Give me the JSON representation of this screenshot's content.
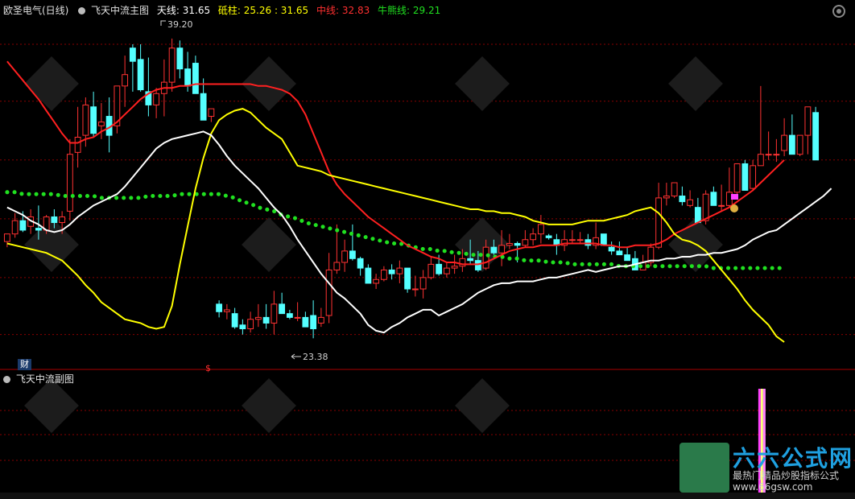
{
  "header": {
    "stock_name": "欧圣电气(日线)",
    "indicator_name": "飞天中流主图",
    "items": [
      {
        "label": "天线: 31.65",
        "color": "#ffffff"
      },
      {
        "label": "砥柱: 25.26 : 31.65",
        "color": "#ffff00"
      },
      {
        "label": "中线: 32.83",
        "color": "#ff3030"
      },
      {
        "label": "牛熊线: 29.21",
        "color": "#20e020"
      }
    ]
  },
  "sub_panel": {
    "title": "飞天中流副图"
  },
  "badges": {
    "cai": "财",
    "dollar": "$"
  },
  "annotations": {
    "high": "39.20",
    "low": "23.38"
  },
  "watermark": {
    "title": "六六公式网",
    "subtitle": "最热门精品炒股指标公式",
    "url": "www.66gsw.com"
  },
  "colors": {
    "up": "#ff3232",
    "down": "#54ffff",
    "tianxian": "#ffffff",
    "dizhu": "#ffff00",
    "zhongxian": "#ff2020",
    "niuxiong": "#20e020",
    "grid": "#8a0000",
    "sub_bar": "#ff40ff"
  },
  "chart_data": {
    "type": "candlestick",
    "ylim": [
      21.8,
      40.3
    ],
    "price_grid": [
      38.9,
      35.9,
      32.8,
      29.7,
      26.6,
      23.6
    ],
    "candles": [
      [
        28.5,
        28.9,
        28.2,
        28.9
      ],
      [
        28.9,
        30.0,
        28.7,
        29.6
      ],
      [
        29.6,
        30.1,
        29.0,
        29.1
      ],
      [
        29.3,
        30.2,
        28.9,
        29.8
      ],
      [
        29.2,
        30.4,
        28.6,
        29.1
      ],
      [
        29.1,
        29.9,
        28.9,
        29.8
      ],
      [
        29.8,
        30.2,
        29.2,
        29.5
      ],
      [
        29.5,
        30.1,
        28.9,
        29.8
      ],
      [
        30.1,
        33.9,
        29.6,
        33.1
      ],
      [
        33.2,
        35.6,
        32.4,
        34.0
      ],
      [
        34.1,
        36.1,
        33.5,
        35.7
      ],
      [
        35.6,
        36.4,
        34.0,
        34.2
      ],
      [
        34.6,
        35.8,
        33.9,
        34.8
      ],
      [
        35.1,
        36.1,
        33.2,
        34.1
      ],
      [
        34.6,
        36.7,
        34.2,
        36.7
      ],
      [
        36.7,
        38.3,
        35.6,
        37.3
      ],
      [
        38.7,
        38.9,
        36.4,
        38.0
      ],
      [
        38.1,
        38.9,
        36.4,
        36.5
      ],
      [
        36.4,
        38.2,
        35.1,
        35.7
      ],
      [
        35.7,
        36.6,
        35.0,
        36.3
      ],
      [
        36.3,
        38.1,
        35.1,
        36.9
      ],
      [
        36.9,
        39.2,
        36.4,
        38.7
      ],
      [
        38.7,
        39.1,
        37.1,
        37.6
      ],
      [
        37.6,
        38.5,
        36.4,
        36.7
      ],
      [
        37.9,
        38.3,
        36.4,
        36.3
      ],
      [
        36.3,
        37.1,
        35.2,
        34.9
      ],
      [
        35.1,
        35.5,
        34.8,
        35.5
      ],
      [
        25.2,
        25.4,
        24.5,
        24.8
      ],
      [
        24.8,
        25.2,
        24.4,
        24.9
      ],
      [
        24.7,
        25.0,
        23.9,
        24.0
      ],
      [
        24.1,
        24.4,
        23.6,
        23.9
      ],
      [
        23.9,
        24.8,
        23.7,
        24.4
      ],
      [
        24.4,
        25.2,
        24.0,
        24.5
      ],
      [
        24.5,
        25.2,
        23.9,
        24.2
      ],
      [
        24.2,
        25.9,
        23.6,
        25.2
      ],
      [
        25.2,
        25.8,
        24.8,
        24.7
      ],
      [
        24.7,
        24.9,
        24.4,
        24.5
      ],
      [
        24.5,
        25.3,
        24.3,
        24.5
      ],
      [
        24.5,
        24.8,
        24.0,
        24.0
      ],
      [
        24.6,
        25.4,
        23.4,
        23.9
      ],
      [
        24.2,
        25.0,
        24.0,
        24.5
      ],
      [
        24.6,
        27.9,
        24.2,
        27.0
      ],
      [
        27.0,
        29.4,
        26.8,
        27.4
      ],
      [
        27.4,
        28.6,
        26.9,
        28.0
      ],
      [
        28.0,
        29.4,
        27.5,
        27.6
      ],
      [
        27.6,
        27.7,
        26.7,
        27.1
      ],
      [
        27.1,
        27.3,
        26.3,
        26.3
      ],
      [
        26.3,
        26.8,
        26.0,
        26.5
      ],
      [
        26.5,
        27.2,
        26.4,
        27.0
      ],
      [
        27.0,
        27.3,
        26.5,
        26.8
      ],
      [
        26.8,
        27.5,
        26.3,
        27.1
      ],
      [
        27.1,
        26.9,
        25.8,
        26.0
      ],
      [
        26.0,
        26.7,
        25.6,
        26.0
      ],
      [
        26.0,
        27.0,
        25.5,
        26.6
      ],
      [
        26.6,
        27.7,
        26.5,
        27.3
      ],
      [
        27.3,
        27.8,
        26.7,
        26.8
      ],
      [
        26.8,
        27.4,
        26.6,
        27.1
      ],
      [
        27.1,
        27.8,
        26.8,
        27.2
      ],
      [
        27.2,
        28.1,
        26.9,
        27.6
      ],
      [
        27.6,
        28.6,
        27.3,
        27.5
      ],
      [
        27.5,
        28.0,
        26.9,
        27.0
      ],
      [
        27.1,
        28.6,
        27.0,
        28.2
      ],
      [
        28.2,
        28.6,
        27.8,
        27.9
      ],
      [
        27.9,
        29.1,
        27.2,
        28.3
      ],
      [
        28.3,
        28.9,
        28.1,
        28.4
      ],
      [
        28.4,
        28.5,
        27.4,
        28.3
      ],
      [
        28.3,
        29.1,
        28.2,
        28.6
      ],
      [
        28.6,
        29.2,
        28.3,
        28.9
      ],
      [
        28.9,
        29.9,
        28.4,
        29.4
      ],
      [
        28.8,
        28.9,
        28.6,
        28.7
      ],
      [
        28.6,
        28.9,
        27.8,
        28.3
      ],
      [
        28.3,
        29.1,
        28.0,
        28.6
      ],
      [
        28.6,
        29.1,
        28.4,
        28.6
      ],
      [
        28.6,
        29.0,
        28.4,
        28.6
      ],
      [
        28.6,
        28.9,
        28.1,
        28.3
      ],
      [
        28.3,
        29.5,
        28.1,
        28.7
      ],
      [
        28.9,
        28.8,
        28.5,
        28.3
      ],
      [
        28.2,
        28.5,
        27.8,
        28.0
      ],
      [
        28.0,
        28.5,
        27.8,
        27.8
      ],
      [
        27.8,
        28.2,
        27.6,
        27.5
      ],
      [
        27.6,
        28.0,
        27.3,
        27.0
      ],
      [
        27.0,
        27.8,
        27.2,
        27.4
      ],
      [
        27.4,
        28.4,
        27.2,
        28.2
      ],
      [
        28.2,
        31.6,
        28.1,
        30.8
      ],
      [
        30.8,
        31.6,
        30.4,
        30.9
      ],
      [
        30.9,
        31.5,
        30.8,
        31.6
      ],
      [
        30.9,
        31.4,
        30.4,
        30.6
      ],
      [
        30.4,
        31.2,
        30.3,
        30.7
      ],
      [
        30.3,
        30.8,
        30.1,
        29.5
      ],
      [
        29.6,
        31.2,
        29.4,
        31.0
      ],
      [
        31.1,
        31.4,
        30.8,
        30.4
      ],
      [
        30.4,
        31.5,
        30.1,
        30.4
      ],
      [
        30.4,
        32.4,
        30.3,
        31.1
      ],
      [
        31.1,
        32.6,
        31.0,
        32.6
      ],
      [
        32.6,
        32.8,
        31.3,
        31.2
      ],
      [
        31.3,
        32.8,
        31.2,
        32.5
      ],
      [
        32.5,
        36.7,
        32.6,
        33.1
      ],
      [
        33.1,
        34.3,
        32.8,
        33.1
      ],
      [
        33.1,
        33.9,
        32.7,
        33.1
      ],
      [
        33.3,
        35.0,
        33.0,
        34.1
      ],
      [
        34.1,
        35.2,
        33.2,
        33.1
      ],
      [
        33.1,
        33.9,
        33.0,
        34.1
      ],
      [
        34.1,
        35.1,
        33.1,
        35.6
      ],
      [
        35.3,
        35.6,
        33.6,
        32.8
      ]
    ],
    "series": [
      {
        "name": "天线",
        "values": [
          30.3,
          30.1,
          29.9,
          29.6,
          29.4,
          29.1,
          29.0,
          29.1,
          29.4,
          29.8,
          30.1,
          30.4,
          30.6,
          30.8,
          31.0,
          31.4,
          31.9,
          32.4,
          32.9,
          33.4,
          33.7,
          33.9,
          34.0,
          34.1,
          34.2,
          34.3,
          34.1,
          33.6,
          33.0,
          32.5,
          32.1,
          31.7,
          31.3,
          30.8,
          30.3,
          29.9,
          29.3,
          28.6,
          28.0,
          27.4,
          26.8,
          26.3,
          25.8,
          25.5,
          25.1,
          24.7,
          24.1,
          23.8,
          23.7,
          24.0,
          24.2,
          24.5,
          24.7,
          24.9,
          24.9,
          24.6,
          24.8,
          25.0,
          25.2,
          25.5,
          25.8,
          26.0,
          26.2,
          26.3,
          26.3,
          26.4,
          26.4,
          26.4,
          26.5,
          26.6,
          26.6,
          26.7,
          26.8,
          26.9,
          27.0,
          26.9,
          27.0,
          27.1,
          27.2,
          27.2,
          27.3,
          27.4,
          27.5,
          27.5,
          27.6,
          27.6,
          27.7,
          27.7,
          27.8,
          27.8,
          27.9,
          27.9,
          28.0,
          28.1,
          28.3,
          28.6,
          28.8,
          29.0,
          29.1,
          29.4,
          29.7,
          30.0,
          30.3,
          30.6,
          30.9,
          31.3
        ]
      },
      {
        "name": "砥柱",
        "values": [
          28.4,
          28.3,
          28.2,
          28.1,
          28.0,
          27.9,
          27.7,
          27.5,
          27.1,
          26.7,
          26.2,
          25.8,
          25.3,
          25.0,
          24.7,
          24.4,
          24.3,
          24.2,
          24.0,
          23.9,
          24.0,
          25.1,
          27.3,
          29.3,
          31.3,
          32.9,
          34.2,
          34.9,
          35.2,
          35.4,
          35.5,
          35.3,
          34.9,
          34.5,
          34.2,
          33.9,
          33.2,
          32.5,
          32.4,
          32.3,
          32.2,
          32.0,
          31.9,
          31.8,
          31.7,
          31.6,
          31.5,
          31.4,
          31.3,
          31.2,
          31.1,
          31.0,
          30.9,
          30.8,
          30.7,
          30.6,
          30.5,
          30.4,
          30.3,
          30.2,
          30.2,
          30.1,
          30.1,
          30.0,
          30.0,
          29.9,
          29.8,
          29.6,
          29.5,
          29.4,
          29.4,
          29.4,
          29.4,
          29.5,
          29.6,
          29.6,
          29.6,
          29.7,
          29.8,
          29.9,
          30.1,
          30.2,
          30.3,
          30.0,
          29.5,
          28.9,
          28.6,
          28.5,
          28.3,
          28.0,
          27.5,
          27.0,
          26.5,
          26.0,
          25.4,
          24.9,
          24.5,
          24.1,
          23.5,
          23.2
        ]
      },
      {
        "name": "中线",
        "values": [
          38.0,
          37.5,
          37.0,
          36.5,
          36.0,
          35.4,
          34.8,
          34.2,
          33.7,
          33.7,
          33.9,
          34.0,
          34.3,
          34.5,
          34.8,
          35.2,
          35.6,
          36.0,
          36.3,
          36.5,
          36.6,
          36.6,
          36.7,
          36.7,
          36.8,
          36.8,
          36.8,
          36.8,
          36.8,
          36.8,
          36.8,
          36.8,
          36.7,
          36.7,
          36.6,
          36.5,
          36.3,
          35.9,
          35.2,
          34.2,
          33.2,
          32.2,
          31.5,
          31.0,
          30.6,
          30.2,
          29.8,
          29.5,
          29.2,
          28.9,
          28.6,
          28.3,
          28.1,
          27.9,
          27.7,
          27.6,
          27.4,
          27.4,
          27.3,
          27.3,
          27.3,
          27.4,
          27.6,
          27.8,
          28.0,
          28.1,
          28.2,
          28.2,
          28.3,
          28.3,
          28.3,
          28.4,
          28.4,
          28.4,
          28.4,
          28.4,
          28.3,
          28.3,
          28.2,
          28.2,
          28.3,
          28.3,
          28.3,
          28.4,
          28.6,
          28.9,
          29.1,
          29.3,
          29.5,
          29.7,
          29.9,
          30.1,
          30.3,
          30.6,
          30.9,
          31.2,
          31.6,
          32.0,
          32.4,
          32.8
        ]
      },
      {
        "name": "牛熊线",
        "values": [
          31.1,
          31.1,
          31.0,
          31.0,
          31.0,
          31.0,
          31.0,
          30.9,
          30.9,
          30.9,
          30.9,
          30.9,
          30.8,
          30.8,
          30.8,
          30.8,
          30.8,
          30.8,
          30.9,
          30.9,
          30.9,
          30.9,
          31.0,
          31.0,
          31.0,
          31.0,
          31.0,
          31.0,
          30.9,
          30.8,
          30.6,
          30.5,
          30.3,
          30.2,
          30.1,
          29.9,
          29.8,
          29.7,
          29.5,
          29.4,
          29.3,
          29.2,
          29.1,
          29.0,
          28.9,
          28.8,
          28.7,
          28.6,
          28.5,
          28.4,
          28.4,
          28.3,
          28.2,
          28.1,
          28.1,
          28.0,
          28.0,
          27.9,
          27.9,
          27.8,
          27.8,
          27.8,
          27.7,
          27.7,
          27.6,
          27.6,
          27.5,
          27.5,
          27.5,
          27.4,
          27.4,
          27.4,
          27.3,
          27.3,
          27.3,
          27.3,
          27.3,
          27.3,
          27.2,
          27.2,
          27.2,
          27.2,
          27.2,
          27.2,
          27.2,
          27.2,
          27.2,
          27.2,
          27.2,
          27.2,
          27.1,
          27.1,
          27.1,
          27.1,
          27.1,
          27.1,
          27.1,
          27.1,
          27.1,
          27.1
        ]
      }
    ],
    "signals": [
      {
        "index": 96,
        "type": "sub_bar"
      }
    ],
    "legend": "top-left"
  }
}
